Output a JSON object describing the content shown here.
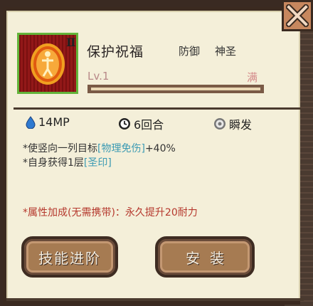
{
  "skill": {
    "name": "保护祝福",
    "rank": "Ⅱ",
    "tags": [
      "防御",
      "神圣"
    ],
    "level_label": "Lv.1",
    "max_label": "满",
    "level_progress": 1.0
  },
  "stats": {
    "mp": "14MP",
    "turns": "6回合",
    "cast": "瞬发"
  },
  "description": {
    "line1_prefix": "*使竖向一列目标",
    "line1_highlight": "[物理免伤]",
    "line1_suffix": "+40%",
    "line2_prefix": "*自身获得1层",
    "line2_highlight": "[圣印]"
  },
  "attribute_bonus": "*属性加成(无需携带)：永久提升20耐力",
  "buttons": {
    "upgrade": "技能进阶",
    "install": "安装"
  },
  "icons": {
    "close": "close-x-icon",
    "mp": "water-drop-icon",
    "turns": "clock-icon",
    "cast": "instant-cast-icon",
    "skill": "blessing-figure-icon"
  },
  "colors": {
    "panel_bg": "#f4efd9",
    "highlight": "#3b9ab3",
    "attribute": "#b5382d",
    "frame_green": "#63b43a"
  }
}
